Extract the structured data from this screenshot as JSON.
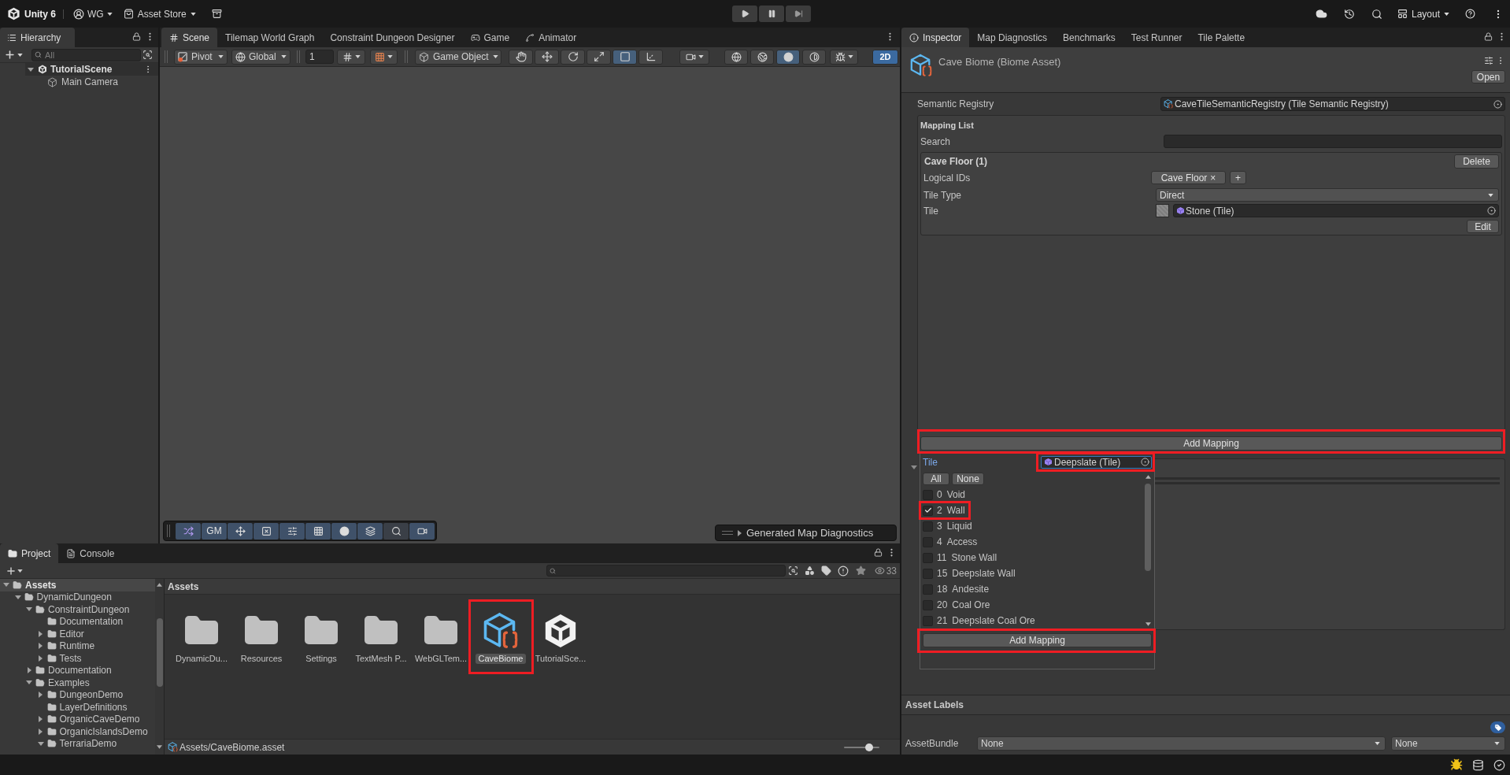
{
  "toolbar": {
    "product": "Unity 6",
    "account": "WG",
    "store": "Asset Store",
    "layout": "Layout"
  },
  "hierarchy": {
    "tab": "Hierarchy",
    "search": {
      "placeholder": "All"
    },
    "tree": [
      {
        "label": "TutorialScene",
        "kind": "scene",
        "expanded": true,
        "children": [
          {
            "label": "Main Camera",
            "kind": "object"
          }
        ]
      }
    ]
  },
  "scene": {
    "tabs": [
      {
        "label": "Scene",
        "kind": "scene",
        "selected": true
      },
      {
        "label": "Tilemap World Graph",
        "kind": "plain",
        "selected": false
      },
      {
        "label": "Constraint Dungeon Designer",
        "kind": "plain",
        "selected": false
      },
      {
        "label": "Game",
        "kind": "game",
        "selected": false
      },
      {
        "label": "Animator",
        "kind": "animator",
        "selected": false
      }
    ],
    "pivot": "Pivot",
    "space": "Global",
    "grid_size": "1",
    "object_mode": "Game Object",
    "tools": [
      {
        "kind": "hand",
        "selected": false
      },
      {
        "kind": "move",
        "selected": false
      },
      {
        "kind": "rotate",
        "selected": false
      },
      {
        "kind": "scale",
        "selected": false
      },
      {
        "kind": "rect",
        "selected": true
      },
      {
        "kind": "transform",
        "selected": false
      }
    ],
    "shading": [
      {
        "kind": "wireframe",
        "selected": false
      },
      {
        "kind": "shaded",
        "selected": false
      },
      {
        "kind": "unlit",
        "selected": true
      },
      {
        "kind": "contrast",
        "selected": false
      }
    ],
    "mode_2d": {
      "label": "2D",
      "selected": true
    },
    "overlay_tools": [
      {
        "kind": "shuffle"
      },
      {
        "kind": "text",
        "label": "GM"
      },
      {
        "kind": "move"
      },
      {
        "kind": "square_x"
      },
      {
        "kind": "sliders"
      },
      {
        "kind": "grid"
      },
      {
        "kind": "circle"
      },
      {
        "kind": "layers"
      },
      {
        "kind": "search"
      },
      {
        "kind": "camera"
      }
    ],
    "diagnostics_overlay": "Generated Map Diagnostics"
  },
  "project": {
    "tabs": [
      {
        "label": "Project",
        "kind": "folder",
        "selected": true
      },
      {
        "label": "Console",
        "kind": "console",
        "selected": false
      }
    ],
    "hidden_count": "33",
    "tree": [
      {
        "label": "Assets",
        "expanded": true,
        "selected": true,
        "children": [
          {
            "label": "DynamicDungeon",
            "expanded": true,
            "selected": false,
            "children": [
              {
                "label": "ConstraintDungeon",
                "expanded": true,
                "selected": false,
                "children": [
                  {
                    "label": "Documentation",
                    "selected": false
                  },
                  {
                    "label": "Editor",
                    "expanded": false,
                    "selected": false
                  },
                  {
                    "label": "Runtime",
                    "expanded": false,
                    "selected": false
                  },
                  {
                    "label": "Tests",
                    "expanded": false,
                    "selected": false
                  }
                ]
              },
              {
                "label": "Documentation",
                "expanded": false,
                "selected": false
              },
              {
                "label": "Examples",
                "expanded": true,
                "selected": false,
                "children": [
                  {
                    "label": "DungeonDemo",
                    "expanded": false,
                    "selected": false
                  },
                  {
                    "label": "LayerDefinitions",
                    "selected": false
                  },
                  {
                    "label": "OrganicCaveDemo",
                    "expanded": false,
                    "selected": false
                  },
                  {
                    "label": "OrganicIslandsDemo",
                    "expanded": false,
                    "selected": false
                  },
                  {
                    "label": "TerrariaDemo",
                    "expanded": true,
                    "selected": false
                  }
                ]
              }
            ]
          }
        ]
      }
    ],
    "breadcrumb": "Assets",
    "items": [
      {
        "label": "DynamicDu...",
        "kind": "folder",
        "selected": false,
        "highlighted": false
      },
      {
        "label": "Resources",
        "kind": "folder",
        "selected": false,
        "highlighted": false
      },
      {
        "label": "Settings",
        "kind": "folder",
        "selected": false,
        "highlighted": false
      },
      {
        "label": "TextMesh P...",
        "kind": "folder",
        "selected": false,
        "highlighted": false
      },
      {
        "label": "WebGLTem...",
        "kind": "folder",
        "selected": false,
        "highlighted": false
      },
      {
        "label": "CaveBiome",
        "kind": "biome",
        "selected": true,
        "highlighted": true
      },
      {
        "label": "TutorialSce...",
        "kind": "scene",
        "selected": false,
        "highlighted": false
      }
    ],
    "path": "Assets/CaveBiome.asset",
    "zoom": {
      "level": 0.7
    }
  },
  "inspector": {
    "tabs": [
      {
        "label": "Inspector",
        "kind": "info",
        "selected": true
      },
      {
        "label": "Map Diagnostics",
        "kind": "plain",
        "selected": false
      },
      {
        "label": "Benchmarks",
        "kind": "plain",
        "selected": false
      },
      {
        "label": "Test Runner",
        "kind": "plain",
        "selected": false
      },
      {
        "label": "Tile Palette",
        "kind": "plain",
        "selected": false
      }
    ],
    "title": "Cave Biome (Biome Asset)",
    "open_button": "Open",
    "semantic_registry": {
      "label": "Semantic Registry",
      "value": "CaveTileSemanticRegistry (Tile Semantic Registry)"
    },
    "mapping_list": {
      "title": "Mapping List",
      "search_label": "Search",
      "mappings": [
        {
          "title": "Cave Floor (1)",
          "delete_button": "Delete",
          "logical_ids_label": "Logical IDs",
          "logical_ids": [
            {
              "label": "Cave Floor",
              "remove": "×"
            }
          ],
          "add_id_button": "+",
          "tile_type_label": "Tile Type",
          "tile_type": "Direct",
          "tile_label": "Tile",
          "tile": "Stone (Tile)",
          "edit_button": "Edit"
        }
      ],
      "add_button": {
        "label": "Add Mapping",
        "highlighted": true
      }
    },
    "tile_picker": {
      "label": "Tile",
      "value": "Deepslate (Tile)",
      "value_highlighted": true,
      "all_button": "All",
      "none_button": "None",
      "options": [
        {
          "id": "0",
          "label": "Void",
          "checked": false,
          "highlighted": false
        },
        {
          "id": "2",
          "label": "Wall",
          "checked": true,
          "highlighted": true
        },
        {
          "id": "3",
          "label": "Liquid",
          "checked": false,
          "highlighted": false
        },
        {
          "id": "4",
          "label": "Access",
          "checked": false,
          "highlighted": false
        },
        {
          "id": "11",
          "label": "Stone Wall",
          "checked": false,
          "highlighted": false
        },
        {
          "id": "15",
          "label": "Deepslate Wall",
          "checked": false,
          "highlighted": false
        },
        {
          "id": "18",
          "label": "Andesite",
          "checked": false,
          "highlighted": false
        },
        {
          "id": "20",
          "label": "Coal Ore",
          "checked": false,
          "highlighted": false
        },
        {
          "id": "21",
          "label": "Deepslate Coal Ore",
          "checked": false,
          "highlighted": false
        }
      ],
      "add_button": {
        "label": "Add Mapping",
        "highlighted": true
      }
    },
    "asset_labels": {
      "title": "Asset Labels",
      "bundle_label": "AssetBundle",
      "bundle": "None",
      "variant": "None"
    }
  }
}
